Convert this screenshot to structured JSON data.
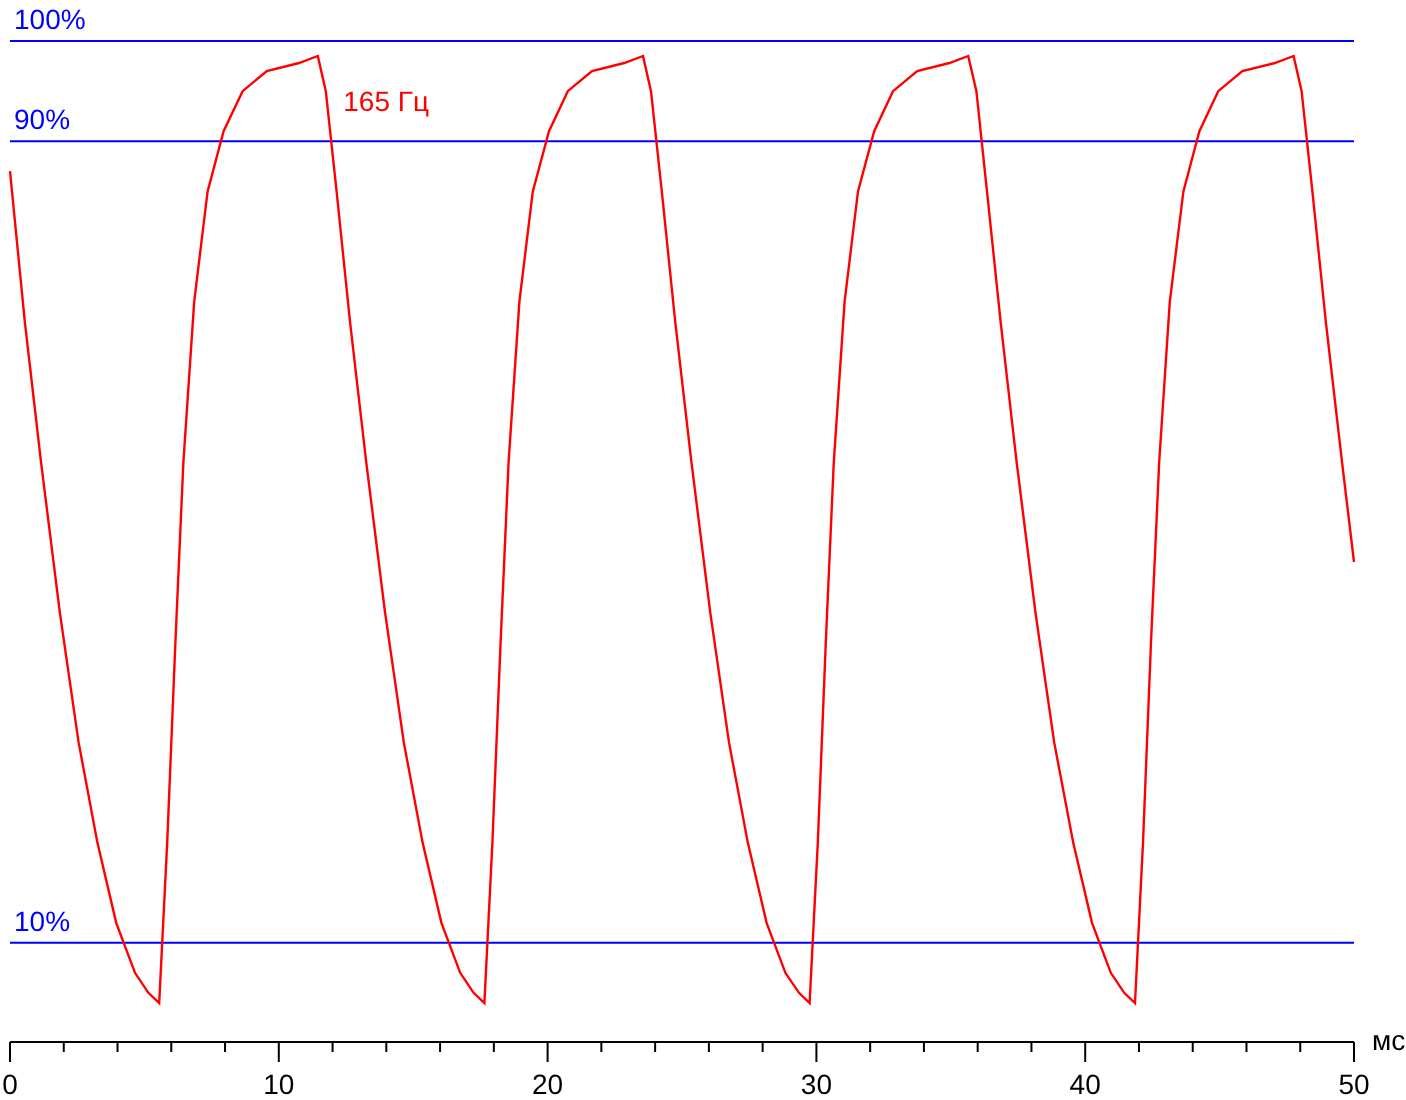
{
  "chart_data": {
    "type": "line",
    "xlabel": "мс",
    "xlim": [
      0,
      50
    ],
    "ylim": [
      0,
      100
    ],
    "xticks": [
      0,
      10,
      20,
      30,
      40,
      50
    ],
    "yticks": [
      {
        "value": 10,
        "label": "10%"
      },
      {
        "value": 90,
        "label": "90%"
      },
      {
        "value": 100,
        "label": "100%"
      }
    ],
    "x": [
      0,
      0.55,
      1.15,
      1.85,
      2.55,
      3.25,
      3.95,
      4.65,
      5.15,
      5.55,
      5.85,
      6.15,
      6.45,
      6.85,
      7.35,
      7.95,
      8.65,
      9.55,
      10.75,
      11.45,
      11.75,
      12.15,
      12.65,
      13.25,
      13.95,
      14.65,
      15.35,
      16.05,
      16.75,
      17.25,
      17.65,
      17.95,
      18.25,
      18.55,
      18.95,
      19.45,
      20.05,
      20.75,
      21.65,
      22.85,
      23.55,
      23.85,
      24.25,
      24.75,
      25.35,
      26.05,
      26.75,
      27.45,
      28.15,
      28.85,
      29.35,
      29.75,
      30.05,
      30.35,
      30.65,
      31.05,
      31.55,
      32.15,
      32.85,
      33.75,
      34.95,
      35.65,
      35.95,
      36.35,
      36.85,
      37.45,
      38.15,
      38.85,
      39.55,
      40.25,
      40.95,
      41.45,
      41.85,
      42.15,
      42.45,
      42.75,
      43.15,
      43.65,
      44.25,
      44.95,
      45.85,
      47.05,
      47.75,
      48.05,
      48.45,
      48.95,
      49.55,
      50
    ],
    "series": [
      {
        "name": "165 Гц",
        "color": "#ff0000",
        "values": [
          87,
          72,
          58,
          43,
          30,
          20,
          12,
          7,
          5,
          4,
          20,
          40,
          58,
          74,
          85,
          91,
          95,
          97,
          97.8,
          98.5,
          95,
          85,
          72,
          58,
          43,
          30,
          20,
          12,
          7,
          5,
          4,
          20,
          40,
          58,
          74,
          85,
          91,
          95,
          97,
          97.8,
          98.5,
          95,
          85,
          72,
          58,
          43,
          30,
          20,
          12,
          7,
          5,
          4,
          20,
          40,
          58,
          74,
          85,
          91,
          95,
          97,
          97.8,
          98.5,
          95,
          85,
          72,
          58,
          43,
          30,
          20,
          12,
          7,
          5,
          4,
          20,
          40,
          58,
          74,
          85,
          91,
          95,
          97,
          97.8,
          98.5,
          95,
          85,
          72,
          58,
          48
        ]
      }
    ]
  }
}
